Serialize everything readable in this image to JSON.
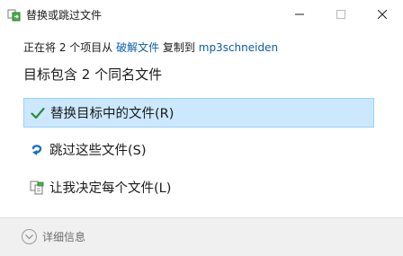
{
  "window": {
    "title": "替换或跳过文件",
    "app_icon": "file-copy-icon",
    "controls": {
      "minimize_icon": "minimize-icon",
      "maximize_icon": "maximize-icon",
      "close_icon": "close-icon"
    }
  },
  "progress": {
    "prefix": "正在将 2 个项目从 ",
    "source": "破解文件",
    "middle": " 复制到 ",
    "destination": "mp3schneiden"
  },
  "heading": "目标包含 2 个同名文件",
  "options": [
    {
      "label": "替换目标中的文件(R)",
      "icon": "checkmark-icon",
      "selected": true
    },
    {
      "label": "跳过这些文件(S)",
      "icon": "skip-arrow-icon",
      "selected": false
    },
    {
      "label": "让我决定每个文件(L)",
      "icon": "compare-files-icon",
      "selected": false
    }
  ],
  "footer": {
    "details_label": "详细信息",
    "details_icon": "chevron-down-icon"
  },
  "colors": {
    "link": "#0b5ea8",
    "selection_bg": "#cce8ff",
    "selection_border": "#99d1ff",
    "check": "#2a8a3a",
    "skip_arrow": "#1f6fb8",
    "footer_bg": "#f0f0f0"
  }
}
